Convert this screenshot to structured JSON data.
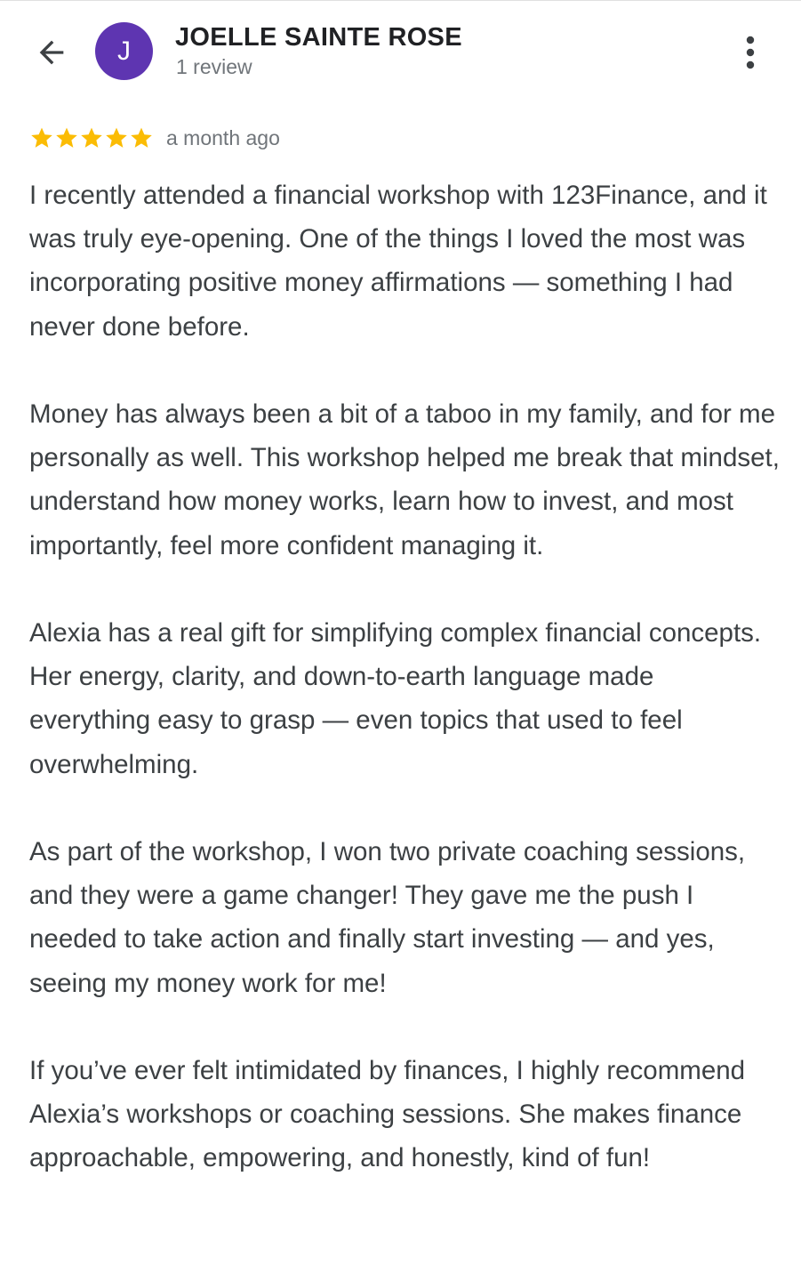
{
  "reviewer": {
    "avatar_initial": "J",
    "avatar_color": "#5e35b1",
    "name": "JOELLE SAINTE ROSE",
    "review_count": "1 review"
  },
  "review": {
    "rating": 5,
    "rating_max": 5,
    "star_color": "#fbbc04",
    "time_ago": "a month ago",
    "paragraphs": [
      "I recently attended a financial workshop with 123Finance, and it was truly eye-opening. One of the things I loved the most was incorporating positive money affirmations — something I had never done before.",
      "Money has always been a bit of a taboo in my family, and for me personally as well. This workshop helped me break that mindset, understand how money works, learn how to invest, and most importantly, feel more confident managing it.",
      "Alexia has a real gift for simplifying complex financial concepts. Her energy, clarity, and down-to-earth language made everything easy to grasp — even topics that used to feel overwhelming.",
      "As part of the workshop, I won two private coaching sessions, and they were a game changer! They gave me the push I needed to take action and finally start investing — and yes, seeing my money work for me!",
      "If you’ve ever felt intimidated by finances, I highly recommend Alexia’s workshops or coaching sessions. She makes finance approachable, empowering, and honestly, kind of fun!"
    ]
  },
  "icons": {
    "back": "arrow-back-icon",
    "more": "more-vert-icon",
    "star": "star-icon"
  }
}
